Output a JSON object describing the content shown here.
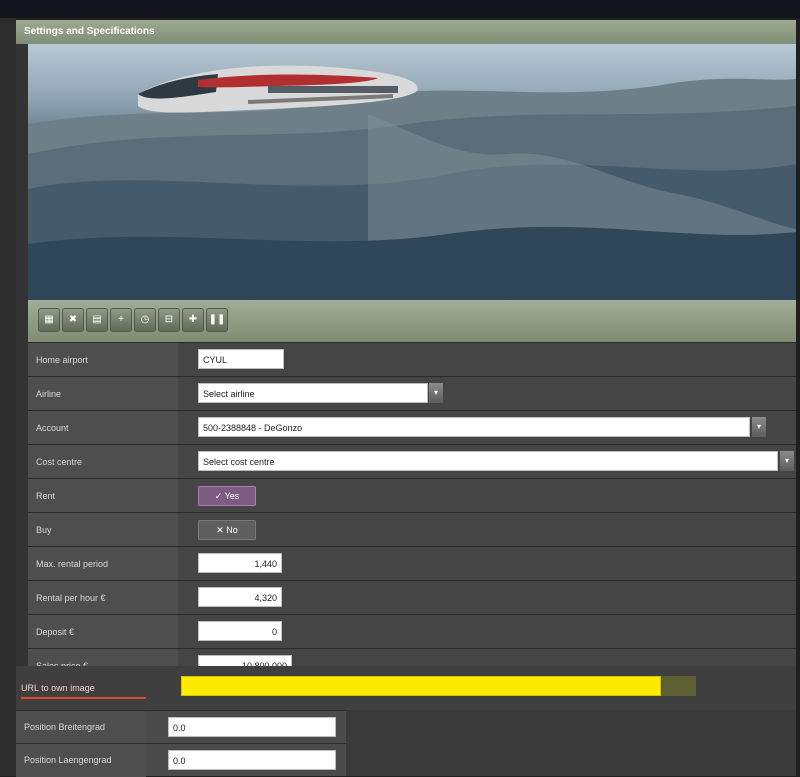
{
  "window": {
    "title": "Settings and Specifications"
  },
  "toolbar": {
    "buttons": [
      "▦",
      "✖",
      "▤",
      "+",
      "◷",
      "⊟",
      "✚",
      "❚❚"
    ]
  },
  "form": {
    "home_airport": {
      "label": "Home airport",
      "value": "CYUL"
    },
    "airline": {
      "label": "Airline",
      "value": "Select airline"
    },
    "account": {
      "label": "Account",
      "value": "500-2388848 - DeGonzo"
    },
    "cost_centre": {
      "label": "Cost centre",
      "value": "Select cost centre"
    },
    "rent": {
      "label": "Rent",
      "value": "✓ Yes"
    },
    "buy": {
      "label": "Buy",
      "value": "✕ No"
    },
    "max_rental": {
      "label": "Max. rental period",
      "value": "1,440"
    },
    "rental_per_hour": {
      "label": "Rental per hour €",
      "value": "4,320"
    },
    "deposit": {
      "label": "Deposit €",
      "value": "0"
    },
    "sales_price": {
      "label": "Sales price €",
      "value": "10,800,000"
    },
    "url_image": {
      "label": "URL to own image",
      "value": ""
    }
  },
  "position": {
    "lat": {
      "label": "Position Breitengrad",
      "value": "0.0"
    },
    "lon": {
      "label": "Position Laengengrad",
      "value": "0.0"
    }
  }
}
